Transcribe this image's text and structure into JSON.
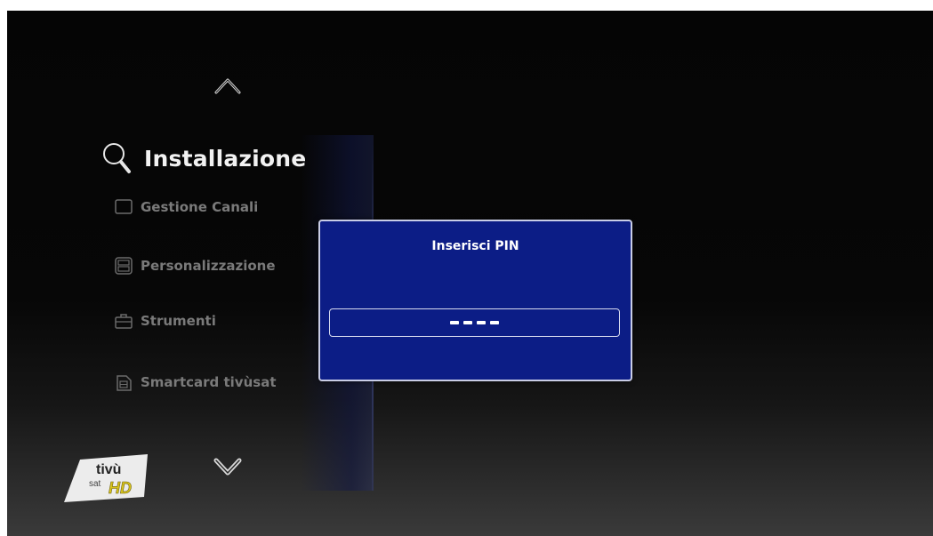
{
  "menu": {
    "title": "Installazione",
    "items": [
      {
        "label": "Gestione Canali",
        "icon": "list-icon"
      },
      {
        "label": "Personalizzazione",
        "icon": "customize-icon"
      },
      {
        "label": "Strumenti",
        "icon": "toolbox-icon"
      },
      {
        "label": "Smartcard tivùsat",
        "icon": "smartcard-icon"
      }
    ]
  },
  "dialog": {
    "title": "Inserisci PIN",
    "pin_masked_count": 4
  },
  "logo": {
    "text_top": "tivù",
    "text_sat": "sat",
    "text_hd": "HD"
  },
  "colors": {
    "dialog_bg": "#0c1d86",
    "dialog_border": "#c9cde6",
    "menu_title": "#f2f2f2",
    "menu_item": "#7a7a7a",
    "logo_hd": "#d9c41a"
  }
}
